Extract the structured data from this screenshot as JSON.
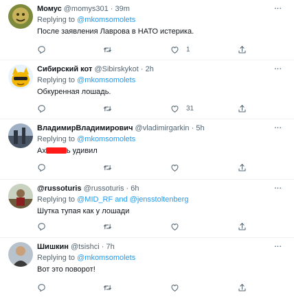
{
  "tweets": [
    {
      "name": "Момус",
      "handle": "@momys301",
      "time": "39m",
      "reply_prefix": "Replying to",
      "reply_to": "@mkomsomolets",
      "text": "После заявления Лаврова в НАТО истерика.",
      "like_count": "1"
    },
    {
      "name": "Сибирский кот",
      "handle": "@Sibirskykot",
      "time": "2h",
      "reply_prefix": "Replying to",
      "reply_to": "@mkomsomolets",
      "text": "Обкуренная лошадь.",
      "like_count": "31"
    },
    {
      "name": "ВладимирВладимирович",
      "handle": "@vladimirgarkin",
      "time": "5h",
      "reply_prefix": "Replying to",
      "reply_to": "@mkomsomolets",
      "text_before": "Ах",
      "text_after": "ь удивил"
    },
    {
      "name": "@russoturis",
      "handle": "@russoturis",
      "time": "6h",
      "reply_prefix": "Replying to",
      "reply_to": "@MID_RF and @jensstoltenberg",
      "text": "Шутка тупая как у лошади"
    },
    {
      "name": "Шишкин",
      "handle": "@tsishci",
      "time": "7h",
      "reply_prefix": "Replying to",
      "reply_to": "@mkomsomolets",
      "text": "Вот это поворот!"
    }
  ],
  "separator": "·",
  "colors": {
    "link": "#1d9bf0",
    "meta": "#536471",
    "redaction": "#ff1a1a"
  },
  "icons": [
    "more-icon",
    "reply-icon",
    "retweet-icon",
    "like-icon",
    "share-icon"
  ]
}
